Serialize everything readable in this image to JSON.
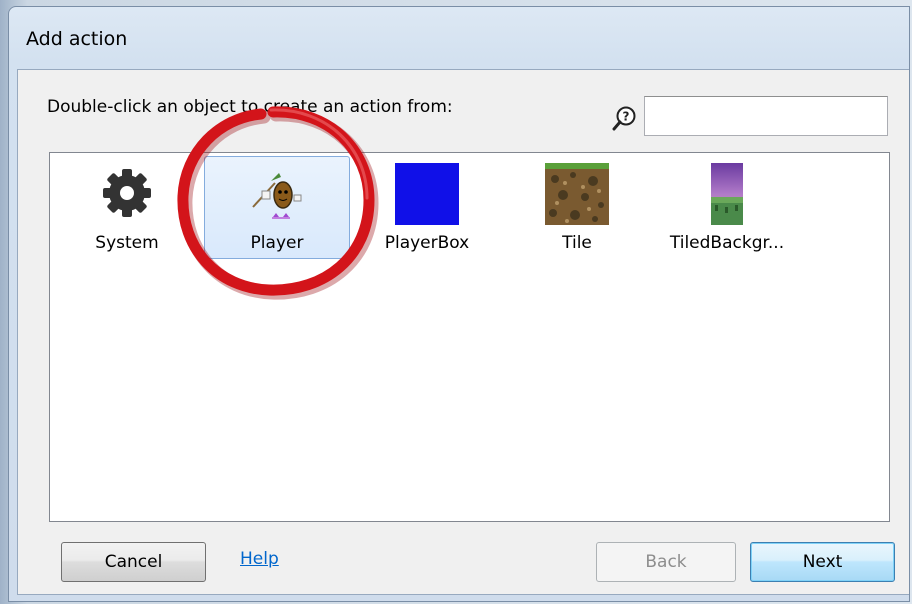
{
  "dialog": {
    "title": "Add action",
    "instruction": "Double-click an object to create an action from:",
    "search": {
      "placeholder": "",
      "value": "",
      "icon": "search-help-icon"
    },
    "objects": [
      {
        "label": "System",
        "icon": "gear-icon",
        "selected": false
      },
      {
        "label": "Player",
        "icon": "player-sprite-icon",
        "selected": true
      },
      {
        "label": "PlayerBox",
        "icon": "blue-square-icon",
        "selected": false
      },
      {
        "label": "Tile",
        "icon": "dirt-tile-icon",
        "selected": false
      },
      {
        "label": "TiledBackgr...",
        "icon": "tiled-background-icon",
        "selected": false
      }
    ],
    "buttons": {
      "cancel": "Cancel",
      "help": "Help",
      "back": "Back",
      "next": "Next"
    }
  },
  "colors": {
    "selection": "#d9e9fc",
    "highlight_ring": "#d3141a",
    "player_box": "#1010e8",
    "link": "#0066cc"
  }
}
